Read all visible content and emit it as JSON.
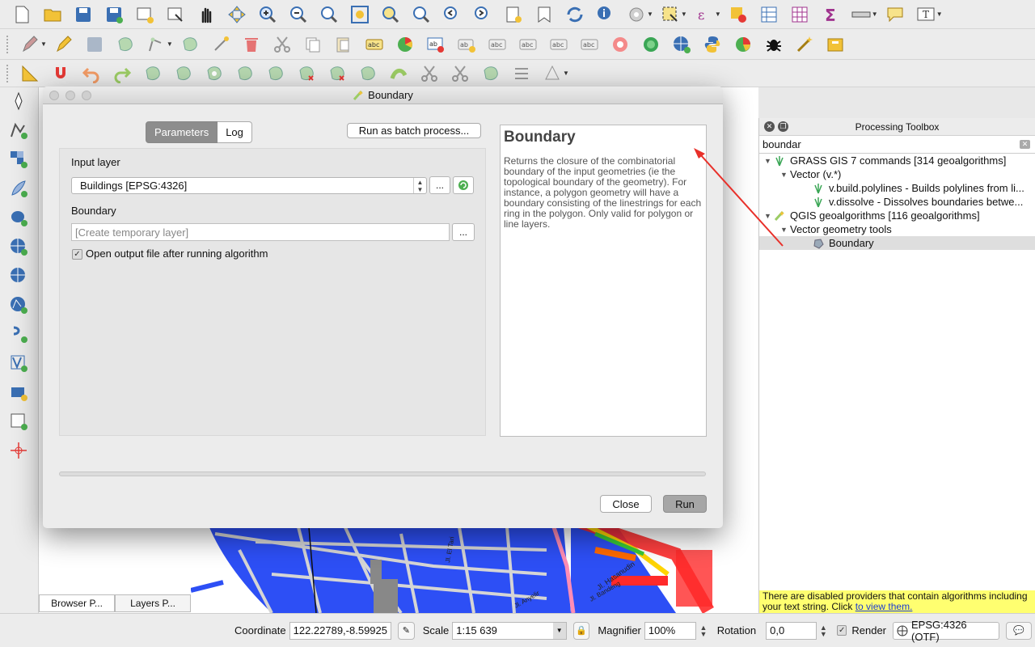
{
  "dialog": {
    "title": "Boundary",
    "tabs": [
      "Parameters",
      "Log"
    ],
    "batch_button": "Run as batch process...",
    "input_layer_label": "Input layer",
    "input_layer_value": "Buildings [EPSG:4326]",
    "browse_button": "...",
    "boundary_label": "Boundary",
    "boundary_placeholder": "[Create temporary layer]",
    "open_output_label": "Open output file after running algorithm",
    "open_output_checked": true,
    "help_title": "Boundary",
    "help_text": "Returns the closure of the combinatorial boundary of the input geometries (ie the topological boundary of the geometry). For instance, a polygon geometry will have a boundary consisting of the linestrings for each ring in the polygon. Only valid for polygon or line layers.",
    "close_button": "Close",
    "run_button": "Run"
  },
  "toolbox": {
    "title": "Processing Toolbox",
    "search_value": "boundar",
    "tree": [
      {
        "label": "GRASS GIS 7 commands [314 geoalgorithms]"
      },
      {
        "label": "Vector (v.*)"
      },
      {
        "label": "v.build.polylines - Builds polylines from li..."
      },
      {
        "label": "v.dissolve - Dissolves boundaries betwe..."
      },
      {
        "label": "QGIS geoalgorithms [116 geoalgorithms]"
      },
      {
        "label": "Vector geometry tools"
      },
      {
        "label": "Boundary"
      }
    ],
    "warning_text": "There are disabled providers that contain algorithms including your text string. Click ",
    "warning_link": "to view them."
  },
  "left_tabs": [
    "Browser P...",
    "Layers P..."
  ],
  "map_labels": [
    "Jl. El Tari",
    "Jl. Hasanudin",
    "Jl. Bandeng",
    "Jl. Anyelir"
  ],
  "status": {
    "coordinate_label": "Coordinate",
    "coordinate_value": "122.22789,-8.59925",
    "scale_label": "Scale",
    "scale_value": "1:15 639",
    "magnifier_label": "Magnifier",
    "magnifier_value": "100%",
    "rotation_label": "Rotation",
    "rotation_value": "0,0",
    "render_label": "Render",
    "render_checked": true,
    "crs_label": "EPSG:4326 (OTF)"
  },
  "colors": {
    "accent_arrow": "#e8302a",
    "map_blue": "#2d4ff5",
    "warning_yellow": "#ffff70"
  }
}
